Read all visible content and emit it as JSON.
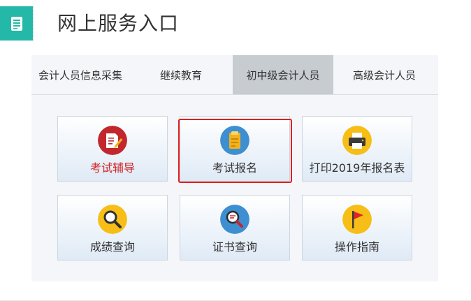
{
  "header": {
    "title": "网上服务入口",
    "icon": "document-icon",
    "accent_color": "#23b8a8"
  },
  "tabs": [
    {
      "label": "会计人员信息采集",
      "active": false
    },
    {
      "label": "继续教育",
      "active": false
    },
    {
      "label": "初中级会计人员",
      "active": true
    },
    {
      "label": "高级会计人员",
      "active": false
    }
  ],
  "tiles": [
    {
      "label": "考试辅导",
      "icon": "edit-document-icon",
      "label_color": "#d01f1f",
      "selected": false
    },
    {
      "label": "考试报名",
      "icon": "registration-clipboard-icon",
      "selected": true
    },
    {
      "label": "打印2019年报名表",
      "icon": "printer-icon",
      "selected": false
    },
    {
      "label": "成绩查询",
      "icon": "magnifier-icon",
      "selected": false
    },
    {
      "label": "证书查询",
      "icon": "certificate-search-icon",
      "selected": false
    },
    {
      "label": "操作指南",
      "icon": "flag-icon",
      "selected": false
    }
  ]
}
